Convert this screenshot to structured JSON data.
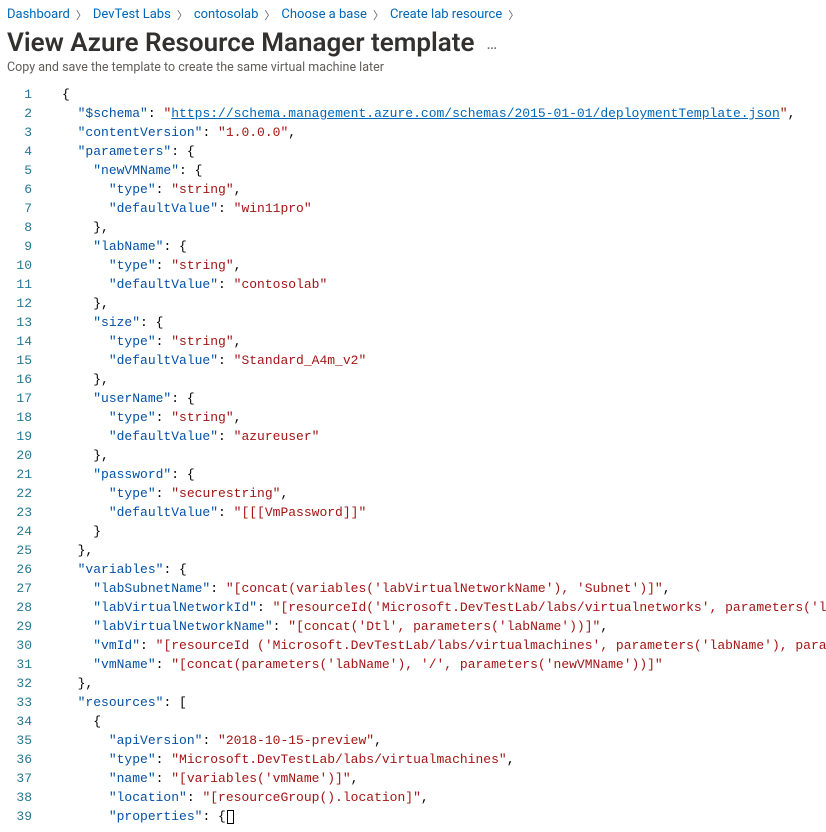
{
  "breadcrumbs": [
    {
      "label": "Dashboard"
    },
    {
      "label": "DevTest Labs"
    },
    {
      "label": "contosolab"
    },
    {
      "label": "Choose a base"
    },
    {
      "label": "Create lab resource"
    }
  ],
  "title": "View Azure Resource Manager template",
  "subtitle": "Copy and save the template to create the same virtual machine later",
  "more": "…",
  "colors": {
    "key": "#0451a5",
    "string": "#a31515",
    "link": "#0067b8"
  },
  "code_lines": [
    [
      [
        "brace",
        "{"
      ]
    ],
    [
      [
        "punc",
        "  "
      ],
      [
        "key",
        "\"$schema\""
      ],
      [
        "punc",
        ": "
      ],
      [
        "link-q",
        "\""
      ],
      [
        "link",
        "https://schema.management.azure.com/schemas/2015-01-01/deploymentTemplate.json"
      ],
      [
        "link-q",
        "\""
      ],
      [
        "punc",
        ","
      ]
    ],
    [
      [
        "punc",
        "  "
      ],
      [
        "key",
        "\"contentVersion\""
      ],
      [
        "punc",
        ": "
      ],
      [
        "string",
        "\"1.0.0.0\""
      ],
      [
        "punc",
        ","
      ]
    ],
    [
      [
        "punc",
        "  "
      ],
      [
        "key",
        "\"parameters\""
      ],
      [
        "punc",
        ": "
      ],
      [
        "brace",
        "{"
      ]
    ],
    [
      [
        "punc",
        "    "
      ],
      [
        "key",
        "\"newVMName\""
      ],
      [
        "punc",
        ": "
      ],
      [
        "brace",
        "{"
      ]
    ],
    [
      [
        "punc",
        "      "
      ],
      [
        "key",
        "\"type\""
      ],
      [
        "punc",
        ": "
      ],
      [
        "string",
        "\"string\""
      ],
      [
        "punc",
        ","
      ]
    ],
    [
      [
        "punc",
        "      "
      ],
      [
        "key",
        "\"defaultValue\""
      ],
      [
        "punc",
        ": "
      ],
      [
        "string",
        "\"win11pro\""
      ]
    ],
    [
      [
        "punc",
        "    "
      ],
      [
        "brace",
        "}"
      ],
      [
        "punc",
        ","
      ]
    ],
    [
      [
        "punc",
        "    "
      ],
      [
        "key",
        "\"labName\""
      ],
      [
        "punc",
        ": "
      ],
      [
        "brace",
        "{"
      ]
    ],
    [
      [
        "punc",
        "      "
      ],
      [
        "key",
        "\"type\""
      ],
      [
        "punc",
        ": "
      ],
      [
        "string",
        "\"string\""
      ],
      [
        "punc",
        ","
      ]
    ],
    [
      [
        "punc",
        "      "
      ],
      [
        "key",
        "\"defaultValue\""
      ],
      [
        "punc",
        ": "
      ],
      [
        "string",
        "\"contosolab\""
      ]
    ],
    [
      [
        "punc",
        "    "
      ],
      [
        "brace",
        "}"
      ],
      [
        "punc",
        ","
      ]
    ],
    [
      [
        "punc",
        "    "
      ],
      [
        "key",
        "\"size\""
      ],
      [
        "punc",
        ": "
      ],
      [
        "brace",
        "{"
      ]
    ],
    [
      [
        "punc",
        "      "
      ],
      [
        "key",
        "\"type\""
      ],
      [
        "punc",
        ": "
      ],
      [
        "string",
        "\"string\""
      ],
      [
        "punc",
        ","
      ]
    ],
    [
      [
        "punc",
        "      "
      ],
      [
        "key",
        "\"defaultValue\""
      ],
      [
        "punc",
        ": "
      ],
      [
        "string",
        "\"Standard_A4m_v2\""
      ]
    ],
    [
      [
        "punc",
        "    "
      ],
      [
        "brace",
        "}"
      ],
      [
        "punc",
        ","
      ]
    ],
    [
      [
        "punc",
        "    "
      ],
      [
        "key",
        "\"userName\""
      ],
      [
        "punc",
        ": "
      ],
      [
        "brace",
        "{"
      ]
    ],
    [
      [
        "punc",
        "      "
      ],
      [
        "key",
        "\"type\""
      ],
      [
        "punc",
        ": "
      ],
      [
        "string",
        "\"string\""
      ],
      [
        "punc",
        ","
      ]
    ],
    [
      [
        "punc",
        "      "
      ],
      [
        "key",
        "\"defaultValue\""
      ],
      [
        "punc",
        ": "
      ],
      [
        "string",
        "\"azureuser\""
      ]
    ],
    [
      [
        "punc",
        "    "
      ],
      [
        "brace",
        "}"
      ],
      [
        "punc",
        ","
      ]
    ],
    [
      [
        "punc",
        "    "
      ],
      [
        "key",
        "\"password\""
      ],
      [
        "punc",
        ": "
      ],
      [
        "brace",
        "{"
      ]
    ],
    [
      [
        "punc",
        "      "
      ],
      [
        "key",
        "\"type\""
      ],
      [
        "punc",
        ": "
      ],
      [
        "string",
        "\"securestring\""
      ],
      [
        "punc",
        ","
      ]
    ],
    [
      [
        "punc",
        "      "
      ],
      [
        "key",
        "\"defaultValue\""
      ],
      [
        "punc",
        ": "
      ],
      [
        "string",
        "\"[[[VmPassword]]\""
      ]
    ],
    [
      [
        "punc",
        "    "
      ],
      [
        "brace",
        "}"
      ]
    ],
    [
      [
        "punc",
        "  "
      ],
      [
        "brace",
        "}"
      ],
      [
        "punc",
        ","
      ]
    ],
    [
      [
        "punc",
        "  "
      ],
      [
        "key",
        "\"variables\""
      ],
      [
        "punc",
        ": "
      ],
      [
        "brace",
        "{"
      ]
    ],
    [
      [
        "punc",
        "    "
      ],
      [
        "key",
        "\"labSubnetName\""
      ],
      [
        "punc",
        ": "
      ],
      [
        "string",
        "\"[concat(variables('labVirtualNetworkName'), 'Subnet')]\""
      ],
      [
        "punc",
        ","
      ]
    ],
    [
      [
        "punc",
        "    "
      ],
      [
        "key",
        "\"labVirtualNetworkId\""
      ],
      [
        "punc",
        ": "
      ],
      [
        "string",
        "\"[resourceId('Microsoft.DevTestLab/labs/virtualnetworks', parameters('labN"
      ]
    ],
    [
      [
        "punc",
        "    "
      ],
      [
        "key",
        "\"labVirtualNetworkName\""
      ],
      [
        "punc",
        ": "
      ],
      [
        "string",
        "\"[concat('Dtl', parameters('labName'))]\""
      ],
      [
        "punc",
        ","
      ]
    ],
    [
      [
        "punc",
        "    "
      ],
      [
        "key",
        "\"vmId\""
      ],
      [
        "punc",
        ": "
      ],
      [
        "string",
        "\"[resourceId ('Microsoft.DevTestLab/labs/virtualmachines', parameters('labName'), paramet"
      ]
    ],
    [
      [
        "punc",
        "    "
      ],
      [
        "key",
        "\"vmName\""
      ],
      [
        "punc",
        ": "
      ],
      [
        "string",
        "\"[concat(parameters('labName'), '/', parameters('newVMName'))]\""
      ]
    ],
    [
      [
        "punc",
        "  "
      ],
      [
        "brace",
        "}"
      ],
      [
        "punc",
        ","
      ]
    ],
    [
      [
        "punc",
        "  "
      ],
      [
        "key",
        "\"resources\""
      ],
      [
        "punc",
        ": "
      ],
      [
        "brace",
        "["
      ]
    ],
    [
      [
        "punc",
        "    "
      ],
      [
        "brace",
        "{"
      ]
    ],
    [
      [
        "punc",
        "      "
      ],
      [
        "key",
        "\"apiVersion\""
      ],
      [
        "punc",
        ": "
      ],
      [
        "string",
        "\"2018-10-15-preview\""
      ],
      [
        "punc",
        ","
      ]
    ],
    [
      [
        "punc",
        "      "
      ],
      [
        "key",
        "\"type\""
      ],
      [
        "punc",
        ": "
      ],
      [
        "string",
        "\"Microsoft.DevTestLab/labs/virtualmachines\""
      ],
      [
        "punc",
        ","
      ]
    ],
    [
      [
        "punc",
        "      "
      ],
      [
        "key",
        "\"name\""
      ],
      [
        "punc",
        ": "
      ],
      [
        "string",
        "\"[variables('vmName')]\""
      ],
      [
        "punc",
        ","
      ]
    ],
    [
      [
        "punc",
        "      "
      ],
      [
        "key",
        "\"location\""
      ],
      [
        "punc",
        ": "
      ],
      [
        "string",
        "\"[resourceGroup().location]\""
      ],
      [
        "punc",
        ","
      ]
    ],
    [
      [
        "punc",
        "      "
      ],
      [
        "key",
        "\"properties\""
      ],
      [
        "punc",
        ": "
      ],
      [
        "brace",
        "{"
      ],
      [
        "caret",
        ""
      ]
    ]
  ]
}
